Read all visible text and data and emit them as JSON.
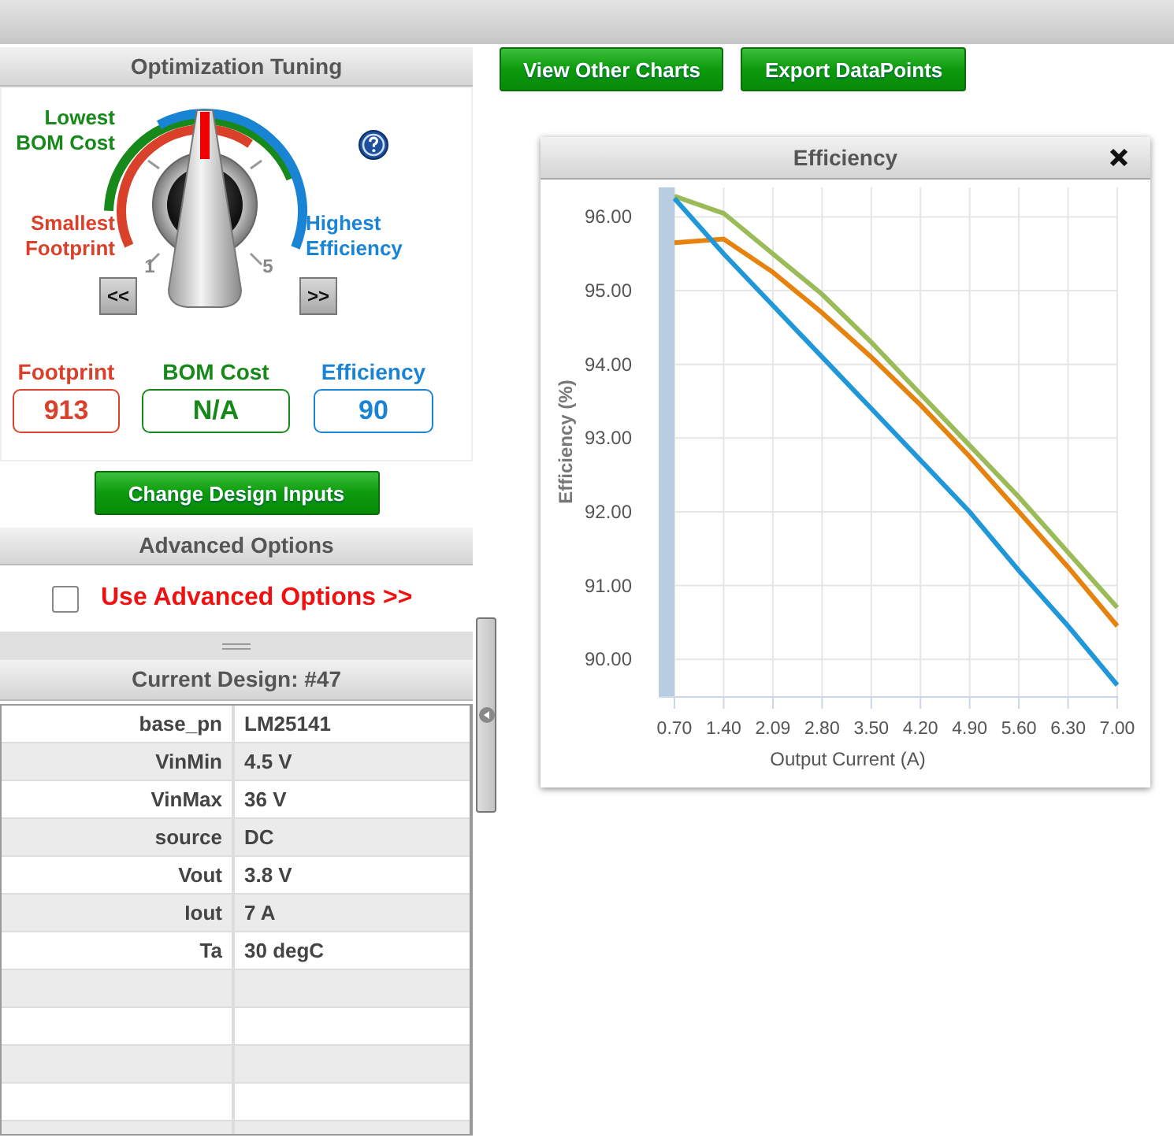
{
  "tuning": {
    "title": "Optimization Tuning",
    "dial": {
      "level": 0.5,
      "scale_min": "1",
      "scale_max": "5",
      "prev_button": "<<",
      "next_button": ">>"
    },
    "goals": [
      {
        "label": "Lowest BOM Cost",
        "color": "#17891a"
      },
      {
        "label": "Smallest Footprint",
        "color": "#d9412b"
      },
      {
        "label": "Highest Efficiency",
        "color": "#1a84d4"
      }
    ],
    "metrics": [
      {
        "label": "Footprint",
        "value": "913",
        "color": "#d9412b"
      },
      {
        "label": "BOM Cost",
        "value": "N/A",
        "color": "#17891a"
      },
      {
        "label": "Efficiency",
        "value": "90",
        "color": "#1a84d4"
      }
    ]
  },
  "change_button": "Change Design Inputs",
  "advanced": {
    "title": "Advanced Options",
    "option": {
      "label": "Use Advanced Options >>",
      "checked": false
    }
  },
  "current_design": {
    "title": "Current Design: #47",
    "rows": [
      {
        "name": "base_pn",
        "value": "LM25141"
      },
      {
        "name": "VinMin",
        "value": "4.5 V"
      },
      {
        "name": "VinMax",
        "value": "36 V"
      },
      {
        "name": "source",
        "value": "DC"
      },
      {
        "name": "Vout",
        "value": "3.8 V"
      },
      {
        "name": "Iout",
        "value": "7 A"
      },
      {
        "name": "Ta",
        "value": "30 degC"
      }
    ]
  },
  "toolbar": [
    "View Other Charts",
    "Export DataPoints"
  ],
  "chart_window": {
    "title": "Efficiency",
    "chart_data": {
      "type": "line",
      "grid": true,
      "xlabel": "Output Current (A)",
      "ylabel": "Efficiency (%)",
      "categories": [
        "0.70",
        "1.40",
        "2.09",
        "2.80",
        "3.50",
        "4.20",
        "4.90",
        "5.60",
        "6.30",
        "7.00"
      ],
      "series": [
        {
          "color": "#9bbb59",
          "values": [
            96.28,
            96.05,
            95.5,
            94.95,
            94.3,
            93.6,
            92.9,
            92.2,
            91.45,
            90.7
          ]
        },
        {
          "color": "#e5830e",
          "values": [
            95.65,
            95.7,
            95.25,
            94.7,
            94.1,
            93.45,
            92.75,
            92.0,
            91.25,
            90.45
          ]
        },
        {
          "color": "#1f97d8",
          "values": [
            96.25,
            95.5,
            94.8,
            94.1,
            93.4,
            92.7,
            92.0,
            91.2,
            90.45,
            89.65
          ]
        }
      ],
      "ylim": [
        89.5,
        96.4
      ],
      "yticks": [
        {
          "value": 90,
          "label": "90.00"
        },
        {
          "value": 91,
          "label": "91.00"
        },
        {
          "value": 92,
          "label": "92.00"
        },
        {
          "value": 93,
          "label": "93.00"
        },
        {
          "value": 94,
          "label": "94.00"
        },
        {
          "value": 95,
          "label": "95.00"
        },
        {
          "value": 96,
          "label": "96.00"
        }
      ]
    }
  }
}
